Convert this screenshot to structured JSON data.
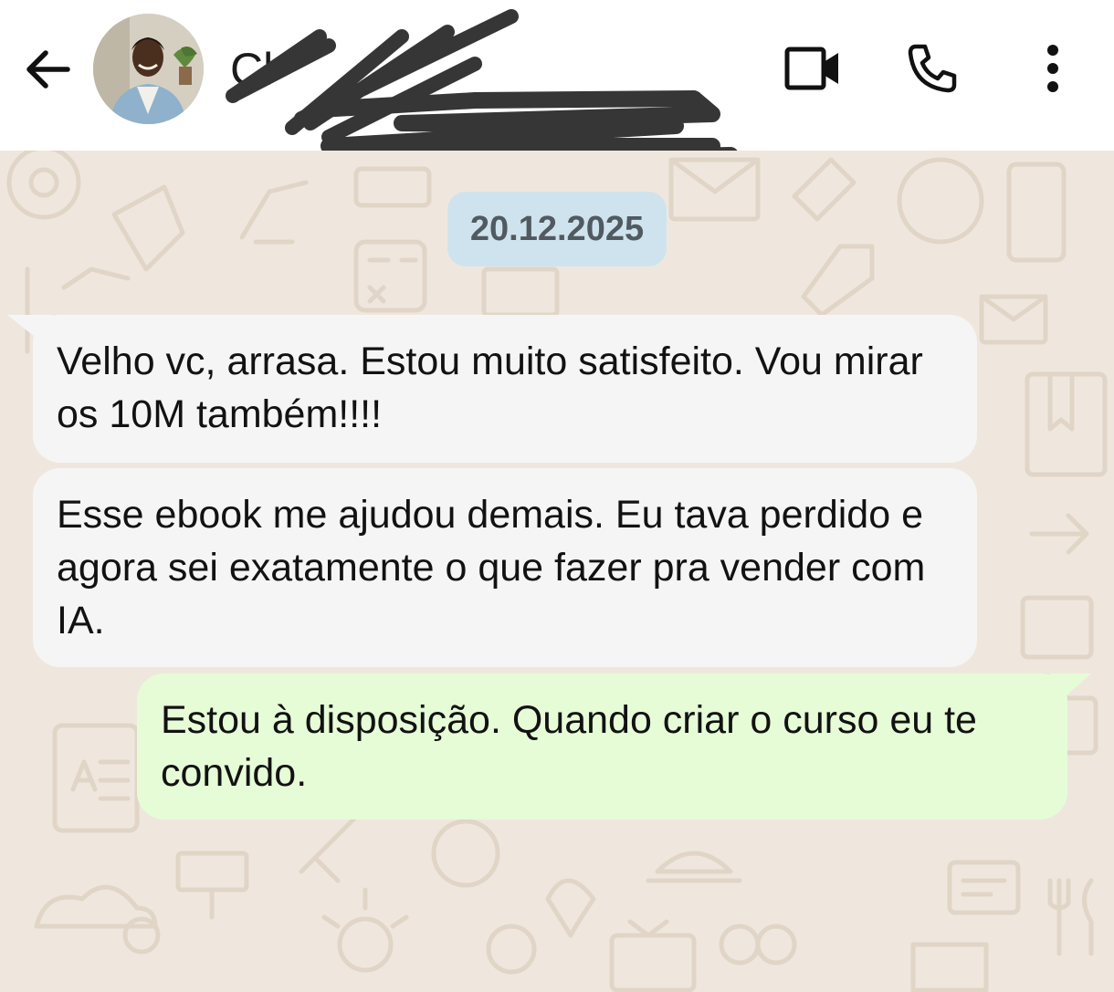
{
  "header": {
    "contact_name": "Cl",
    "back_icon": "arrow-back-icon",
    "actions": [
      {
        "name": "video-call",
        "icon": "video-camera-icon"
      },
      {
        "name": "voice-call",
        "icon": "phone-icon"
      },
      {
        "name": "more-options",
        "icon": "more-vert-icon"
      }
    ]
  },
  "chat": {
    "date": "20.12.2025",
    "messages": [
      {
        "direction": "incoming",
        "text": "Velho vc, arrasa. Estou muito satisfeito. Vou mirar os 10M também!!!!"
      },
      {
        "direction": "incoming",
        "text": "Esse ebook me ajudou demais. Eu tava perdido e agora sei exatamente o que fazer pra vender com IA."
      },
      {
        "direction": "outgoing",
        "text": "Estou à disposição. Quando criar o curso eu te convido."
      }
    ]
  },
  "colors": {
    "header_bg": "#ffffff",
    "chat_bg": "#efe7dd",
    "incoming_bubble": "#f5f5f5",
    "outgoing_bubble": "#e6fcd7",
    "date_chip": "#cfe3ee",
    "redaction": "#333333"
  }
}
